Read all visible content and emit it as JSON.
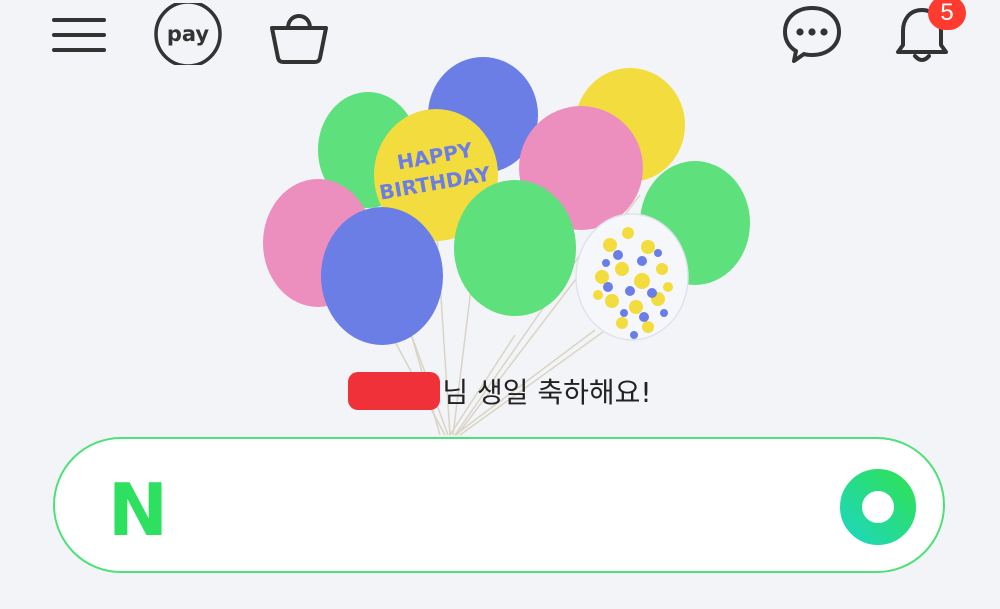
{
  "header": {
    "pay_label": "pay",
    "notification_count": "5"
  },
  "greeting": {
    "suffix": "님 생일 축하해요!"
  },
  "balloon": {
    "text_line1": "HAPPY",
    "text_line2": "BIRTHDAY"
  },
  "search": {
    "logo_letter": "N",
    "placeholder": "",
    "value": ""
  },
  "colors": {
    "naver_green": "#2ee05f",
    "badge_red": "#ff3b30",
    "redaction_red": "#f0313a",
    "balloon_green": "#5ee07c",
    "balloon_blue": "#6a7ee6",
    "balloon_pink": "#ec8fbf",
    "balloon_yellow": "#f3dc3e"
  },
  "icons": [
    "menu-icon",
    "pay-icon",
    "shopping-bag-icon",
    "chat-icon",
    "bell-icon",
    "naver-logo",
    "search-icon"
  ]
}
